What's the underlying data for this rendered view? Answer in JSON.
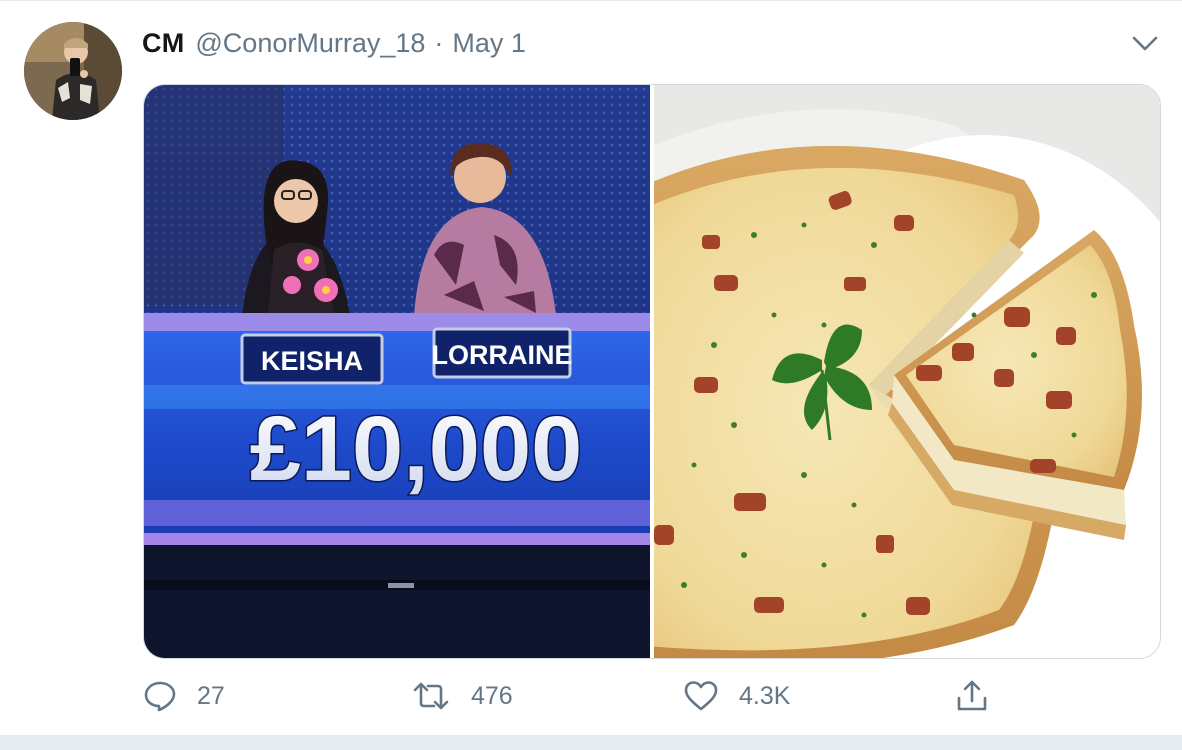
{
  "tweet": {
    "display_name": "CM",
    "handle": "@ConorMurray_18",
    "separator": "·",
    "date": "May 1",
    "media": {
      "left": {
        "contestant_1": "KEISHA",
        "contestant_2": "LORRAINE",
        "amount": "£10,000"
      },
      "right_icon": "quiche-photo"
    },
    "actions": {
      "reply_count": "27",
      "retweet_count": "476",
      "like_count": "4.3K"
    }
  },
  "icons": {
    "reply": "speech-bubble-icon",
    "retweet": "retweet-icon",
    "like": "heart-icon",
    "share": "share-icon",
    "more": "chevron-down-icon"
  },
  "colors": {
    "text_primary": "#14171a",
    "text_secondary": "#657786",
    "border": "#cfd9de",
    "show_blue": "#1d3fb8"
  }
}
